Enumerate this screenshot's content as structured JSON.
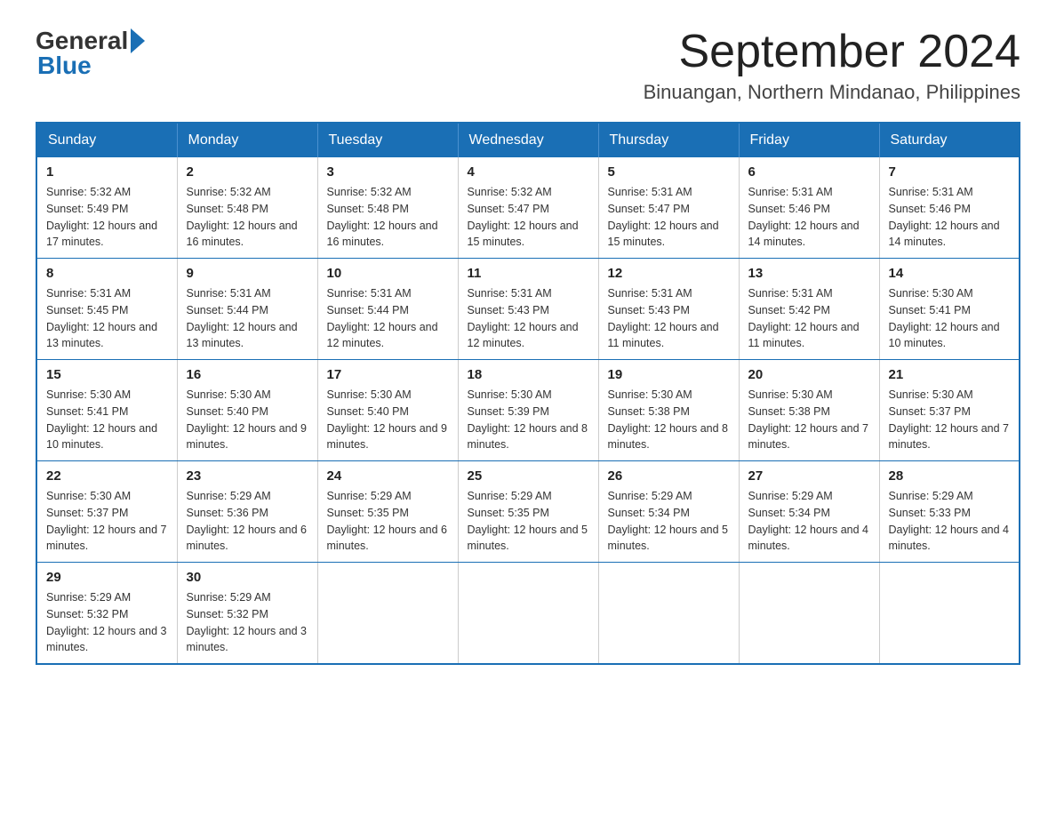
{
  "header": {
    "logo_general": "General",
    "logo_blue": "Blue",
    "month_title": "September 2024",
    "location": "Binuangan, Northern Mindanao, Philippines"
  },
  "days_of_week": [
    "Sunday",
    "Monday",
    "Tuesday",
    "Wednesday",
    "Thursday",
    "Friday",
    "Saturday"
  ],
  "weeks": [
    [
      {
        "day": "1",
        "sunrise": "5:32 AM",
        "sunset": "5:49 PM",
        "daylight": "12 hours and 17 minutes."
      },
      {
        "day": "2",
        "sunrise": "5:32 AM",
        "sunset": "5:48 PM",
        "daylight": "12 hours and 16 minutes."
      },
      {
        "day": "3",
        "sunrise": "5:32 AM",
        "sunset": "5:48 PM",
        "daylight": "12 hours and 16 minutes."
      },
      {
        "day": "4",
        "sunrise": "5:32 AM",
        "sunset": "5:47 PM",
        "daylight": "12 hours and 15 minutes."
      },
      {
        "day": "5",
        "sunrise": "5:31 AM",
        "sunset": "5:47 PM",
        "daylight": "12 hours and 15 minutes."
      },
      {
        "day": "6",
        "sunrise": "5:31 AM",
        "sunset": "5:46 PM",
        "daylight": "12 hours and 14 minutes."
      },
      {
        "day": "7",
        "sunrise": "5:31 AM",
        "sunset": "5:46 PM",
        "daylight": "12 hours and 14 minutes."
      }
    ],
    [
      {
        "day": "8",
        "sunrise": "5:31 AM",
        "sunset": "5:45 PM",
        "daylight": "12 hours and 13 minutes."
      },
      {
        "day": "9",
        "sunrise": "5:31 AM",
        "sunset": "5:44 PM",
        "daylight": "12 hours and 13 minutes."
      },
      {
        "day": "10",
        "sunrise": "5:31 AM",
        "sunset": "5:44 PM",
        "daylight": "12 hours and 12 minutes."
      },
      {
        "day": "11",
        "sunrise": "5:31 AM",
        "sunset": "5:43 PM",
        "daylight": "12 hours and 12 minutes."
      },
      {
        "day": "12",
        "sunrise": "5:31 AM",
        "sunset": "5:43 PM",
        "daylight": "12 hours and 11 minutes."
      },
      {
        "day": "13",
        "sunrise": "5:31 AM",
        "sunset": "5:42 PM",
        "daylight": "12 hours and 11 minutes."
      },
      {
        "day": "14",
        "sunrise": "5:30 AM",
        "sunset": "5:41 PM",
        "daylight": "12 hours and 10 minutes."
      }
    ],
    [
      {
        "day": "15",
        "sunrise": "5:30 AM",
        "sunset": "5:41 PM",
        "daylight": "12 hours and 10 minutes."
      },
      {
        "day": "16",
        "sunrise": "5:30 AM",
        "sunset": "5:40 PM",
        "daylight": "12 hours and 9 minutes."
      },
      {
        "day": "17",
        "sunrise": "5:30 AM",
        "sunset": "5:40 PM",
        "daylight": "12 hours and 9 minutes."
      },
      {
        "day": "18",
        "sunrise": "5:30 AM",
        "sunset": "5:39 PM",
        "daylight": "12 hours and 8 minutes."
      },
      {
        "day": "19",
        "sunrise": "5:30 AM",
        "sunset": "5:38 PM",
        "daylight": "12 hours and 8 minutes."
      },
      {
        "day": "20",
        "sunrise": "5:30 AM",
        "sunset": "5:38 PM",
        "daylight": "12 hours and 7 minutes."
      },
      {
        "day": "21",
        "sunrise": "5:30 AM",
        "sunset": "5:37 PM",
        "daylight": "12 hours and 7 minutes."
      }
    ],
    [
      {
        "day": "22",
        "sunrise": "5:30 AM",
        "sunset": "5:37 PM",
        "daylight": "12 hours and 7 minutes."
      },
      {
        "day": "23",
        "sunrise": "5:29 AM",
        "sunset": "5:36 PM",
        "daylight": "12 hours and 6 minutes."
      },
      {
        "day": "24",
        "sunrise": "5:29 AM",
        "sunset": "5:35 PM",
        "daylight": "12 hours and 6 minutes."
      },
      {
        "day": "25",
        "sunrise": "5:29 AM",
        "sunset": "5:35 PM",
        "daylight": "12 hours and 5 minutes."
      },
      {
        "day": "26",
        "sunrise": "5:29 AM",
        "sunset": "5:34 PM",
        "daylight": "12 hours and 5 minutes."
      },
      {
        "day": "27",
        "sunrise": "5:29 AM",
        "sunset": "5:34 PM",
        "daylight": "12 hours and 4 minutes."
      },
      {
        "day": "28",
        "sunrise": "5:29 AM",
        "sunset": "5:33 PM",
        "daylight": "12 hours and 4 minutes."
      }
    ],
    [
      {
        "day": "29",
        "sunrise": "5:29 AM",
        "sunset": "5:32 PM",
        "daylight": "12 hours and 3 minutes."
      },
      {
        "day": "30",
        "sunrise": "5:29 AM",
        "sunset": "5:32 PM",
        "daylight": "12 hours and 3 minutes."
      },
      null,
      null,
      null,
      null,
      null
    ]
  ],
  "labels": {
    "sunrise_prefix": "Sunrise: ",
    "sunset_prefix": "Sunset: ",
    "daylight_prefix": "Daylight: "
  }
}
